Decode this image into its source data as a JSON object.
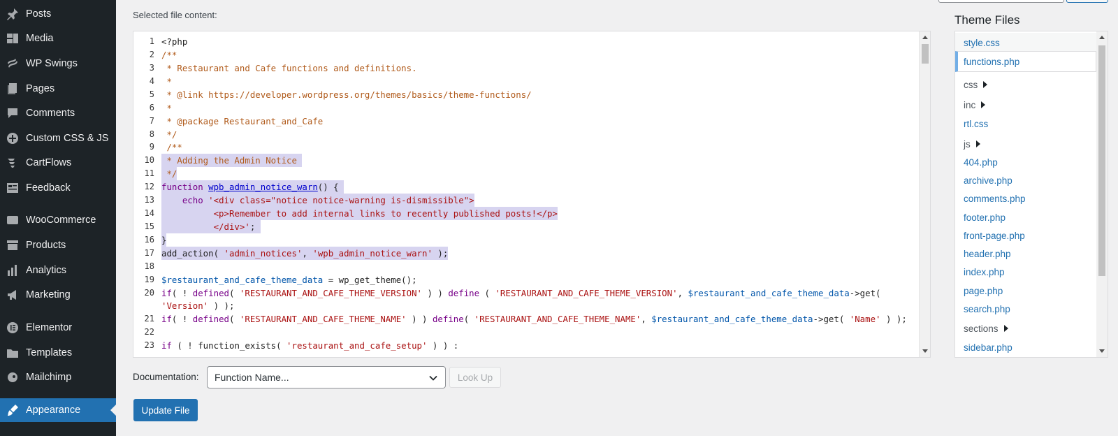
{
  "sidebar": {
    "items": [
      {
        "label": "Posts",
        "icon": "pin-icon"
      },
      {
        "label": "Media",
        "icon": "media-icon"
      },
      {
        "label": "WP Swings",
        "icon": "swings-icon"
      },
      {
        "label": "Pages",
        "icon": "pages-icon"
      },
      {
        "label": "Comments",
        "icon": "comments-icon"
      },
      {
        "label": "Custom CSS & JS",
        "icon": "plus-circle-icon"
      },
      {
        "label": "CartFlows",
        "icon": "cartflows-icon"
      },
      {
        "label": "Feedback",
        "icon": "feedback-icon"
      },
      {
        "label": "WooCommerce",
        "icon": "woo-icon"
      },
      {
        "label": "Products",
        "icon": "archive-icon"
      },
      {
        "label": "Analytics",
        "icon": "bar-chart-icon"
      },
      {
        "label": "Marketing",
        "icon": "megaphone-icon"
      },
      {
        "label": "Elementor",
        "icon": "elementor-icon"
      },
      {
        "label": "Templates",
        "icon": "folder-icon"
      },
      {
        "label": "Mailchimp",
        "icon": "mailchimp-icon"
      },
      {
        "label": "Appearance",
        "icon": "brush-icon",
        "active": true
      }
    ]
  },
  "editor": {
    "label": "Selected file content:",
    "lines": [
      {
        "n": "1",
        "parts": [
          [
            "pl",
            "<?php"
          ]
        ]
      },
      {
        "n": "2",
        "parts": [
          [
            "cm",
            "/**"
          ]
        ]
      },
      {
        "n": "3",
        "parts": [
          [
            "cm",
            " * Restaurant and Cafe functions and definitions."
          ]
        ]
      },
      {
        "n": "4",
        "parts": [
          [
            "cm",
            " *"
          ]
        ]
      },
      {
        "n": "5",
        "parts": [
          [
            "cm",
            " * @link https://developer.wordpress.org/themes/basics/theme-functions/"
          ]
        ]
      },
      {
        "n": "6",
        "parts": [
          [
            "cm",
            " *"
          ]
        ]
      },
      {
        "n": "7",
        "parts": [
          [
            "cm",
            " * @package Restaurant_and_Cafe"
          ]
        ]
      },
      {
        "n": "8",
        "parts": [
          [
            "cm",
            " */"
          ]
        ]
      },
      {
        "n": "9",
        "parts": [
          [
            "cm",
            " /**"
          ]
        ]
      },
      {
        "n": "10",
        "hl": true,
        "parts": [
          [
            "cm",
            " * Adding the Admin Notice "
          ]
        ]
      },
      {
        "n": "11",
        "hl": true,
        "parts": [
          [
            "cm",
            " */"
          ]
        ]
      },
      {
        "n": "12",
        "hl": true,
        "parts": [
          [
            "kw",
            "function "
          ],
          [
            "fn",
            "wpb_admin_notice_warn"
          ],
          [
            "pl",
            "() { "
          ]
        ]
      },
      {
        "n": "13",
        "hl": true,
        "parts": [
          [
            "pl",
            "    "
          ],
          [
            "kw",
            "echo "
          ],
          [
            "st",
            "'<div class=\"notice notice-warning is-dismissible\">"
          ]
        ]
      },
      {
        "n": "14",
        "hl": true,
        "parts": [
          [
            "st",
            "          <p>Remember to add internal links to recently published posts!</p>"
          ]
        ]
      },
      {
        "n": "15",
        "hl": true,
        "parts": [
          [
            "st",
            "          </div>'"
          ],
          [
            "pl",
            "; "
          ]
        ]
      },
      {
        "n": "16",
        "hl": true,
        "parts": [
          [
            "pl",
            "}"
          ]
        ]
      },
      {
        "n": "17",
        "hl": true,
        "parts": [
          [
            "pl",
            "add_action( "
          ],
          [
            "st",
            "'admin_notices'"
          ],
          [
            "pl",
            ", "
          ],
          [
            "st",
            "'wpb_admin_notice_warn'"
          ],
          [
            "pl",
            " );"
          ]
        ]
      },
      {
        "n": "18",
        "parts": [
          [
            "pl",
            ""
          ]
        ]
      },
      {
        "n": "19",
        "parts": [
          [
            "vr",
            "$restaurant_and_cafe_theme_data"
          ],
          [
            "pl",
            " = wp_get_theme();"
          ]
        ]
      },
      {
        "n": "20",
        "parts": [
          [
            "kw",
            "if"
          ],
          [
            "pl",
            "( ! "
          ],
          [
            "kw",
            "defined"
          ],
          [
            "pl",
            "( "
          ],
          [
            "st",
            "'RESTAURANT_AND_CAFE_THEME_VERSION'"
          ],
          [
            "pl",
            " ) ) "
          ],
          [
            "kw",
            "define"
          ],
          [
            "pl",
            " ( "
          ],
          [
            "st",
            "'RESTAURANT_AND_CAFE_THEME_VERSION'"
          ],
          [
            "pl",
            ", "
          ],
          [
            "vr",
            "$restaurant_and_cafe_theme_data"
          ],
          [
            "pl",
            "->get("
          ]
        ]
      },
      {
        "n": "",
        "parts": [
          [
            "st",
            "'Version'"
          ],
          [
            "pl",
            " ) );"
          ]
        ]
      },
      {
        "n": "21",
        "parts": [
          [
            "kw",
            "if"
          ],
          [
            "pl",
            "( ! "
          ],
          [
            "kw",
            "defined"
          ],
          [
            "pl",
            "( "
          ],
          [
            "st",
            "'RESTAURANT_AND_CAFE_THEME_NAME'"
          ],
          [
            "pl",
            " ) ) "
          ],
          [
            "kw",
            "define"
          ],
          [
            "pl",
            "( "
          ],
          [
            "st",
            "'RESTAURANT_AND_CAFE_THEME_NAME'"
          ],
          [
            "pl",
            ", "
          ],
          [
            "vr",
            "$restaurant_and_cafe_theme_data"
          ],
          [
            "pl",
            "->get( "
          ],
          [
            "st",
            "'Name'"
          ],
          [
            "pl",
            " ) );"
          ]
        ]
      },
      {
        "n": "22",
        "parts": [
          [
            "pl",
            ""
          ]
        ]
      },
      {
        "n": "23",
        "parts": [
          [
            "kw",
            "if"
          ],
          [
            "pl",
            " ( ! function_exists( "
          ],
          [
            "st",
            "'restaurant_and_cafe_setup'"
          ],
          [
            "pl",
            " ) ) :"
          ]
        ]
      }
    ]
  },
  "theme_files": {
    "title": "Theme Files",
    "items": [
      {
        "label": "style.css",
        "type": "file"
      },
      {
        "label": "functions.php",
        "type": "file",
        "current": true
      },
      {
        "label": "css",
        "type": "dir"
      },
      {
        "label": "inc",
        "type": "dir"
      },
      {
        "label": "rtl.css",
        "type": "file"
      },
      {
        "label": "js",
        "type": "dir"
      },
      {
        "label": "404.php",
        "type": "file"
      },
      {
        "label": "archive.php",
        "type": "file"
      },
      {
        "label": "comments.php",
        "type": "file"
      },
      {
        "label": "footer.php",
        "type": "file"
      },
      {
        "label": "front-page.php",
        "type": "file"
      },
      {
        "label": "header.php",
        "type": "file"
      },
      {
        "label": "index.php",
        "type": "file"
      },
      {
        "label": "page.php",
        "type": "file"
      },
      {
        "label": "search.php",
        "type": "file"
      },
      {
        "label": "sections",
        "type": "dir"
      },
      {
        "label": "sidebar.php",
        "type": "file"
      }
    ]
  },
  "documentation": {
    "label": "Documentation:",
    "select_value": "Function Name...",
    "lookup_label": "Look Up"
  },
  "update_label": "Update File",
  "colors": {
    "sidebar_bg": "#1d2327",
    "accent": "#2271b1",
    "highlight": "#d7d4f0"
  }
}
